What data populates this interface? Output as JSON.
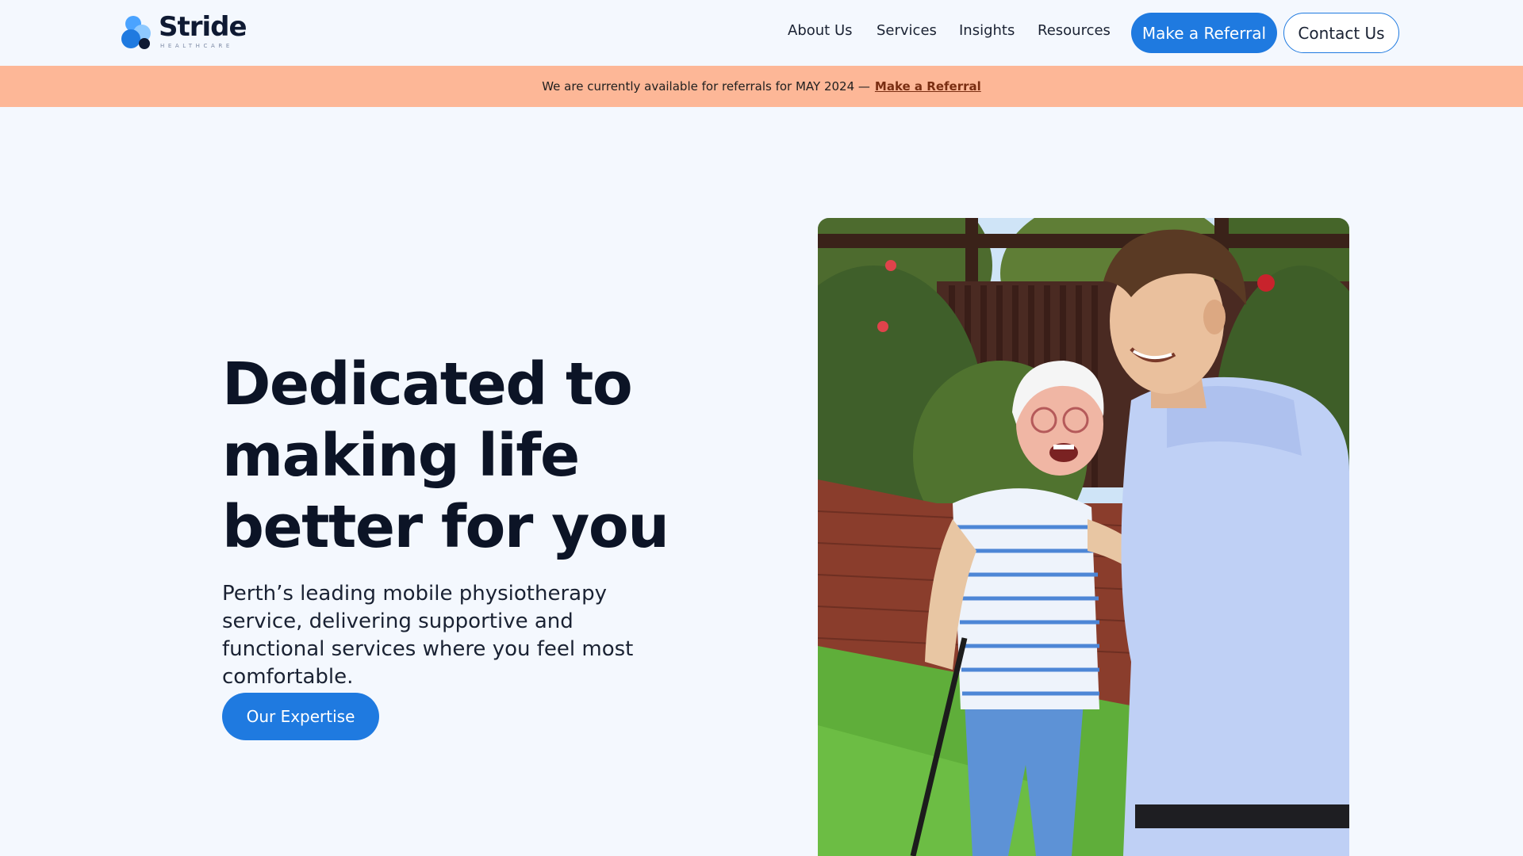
{
  "header": {
    "logo_text": "Stride",
    "logo_subtext": "HEALTHCARE",
    "nav": [
      {
        "label": "About Us"
      },
      {
        "label": "Services"
      },
      {
        "label": "Insights"
      },
      {
        "label": "Resources"
      }
    ],
    "referral_button": "Make a Referral",
    "contact_button": "Contact Us"
  },
  "announcement": {
    "text": "We are currently available for referrals for MAY 2024 —",
    "link": "Make a Referral"
  },
  "hero": {
    "title": "Dedicated to making life better for you",
    "subtitle": "Perth’s leading mobile physiotherapy service, delivering supportive and functional services where you feel most comfortable.",
    "cta": "Our Expertise",
    "image_icon": "photo-elderly-woman-and-physiotherapist-in-garden"
  },
  "colors": {
    "background": "#f4f8fe",
    "primary": "#1f7ae0",
    "announcement_bg": "#fdb797",
    "heading": "#0c1426"
  }
}
